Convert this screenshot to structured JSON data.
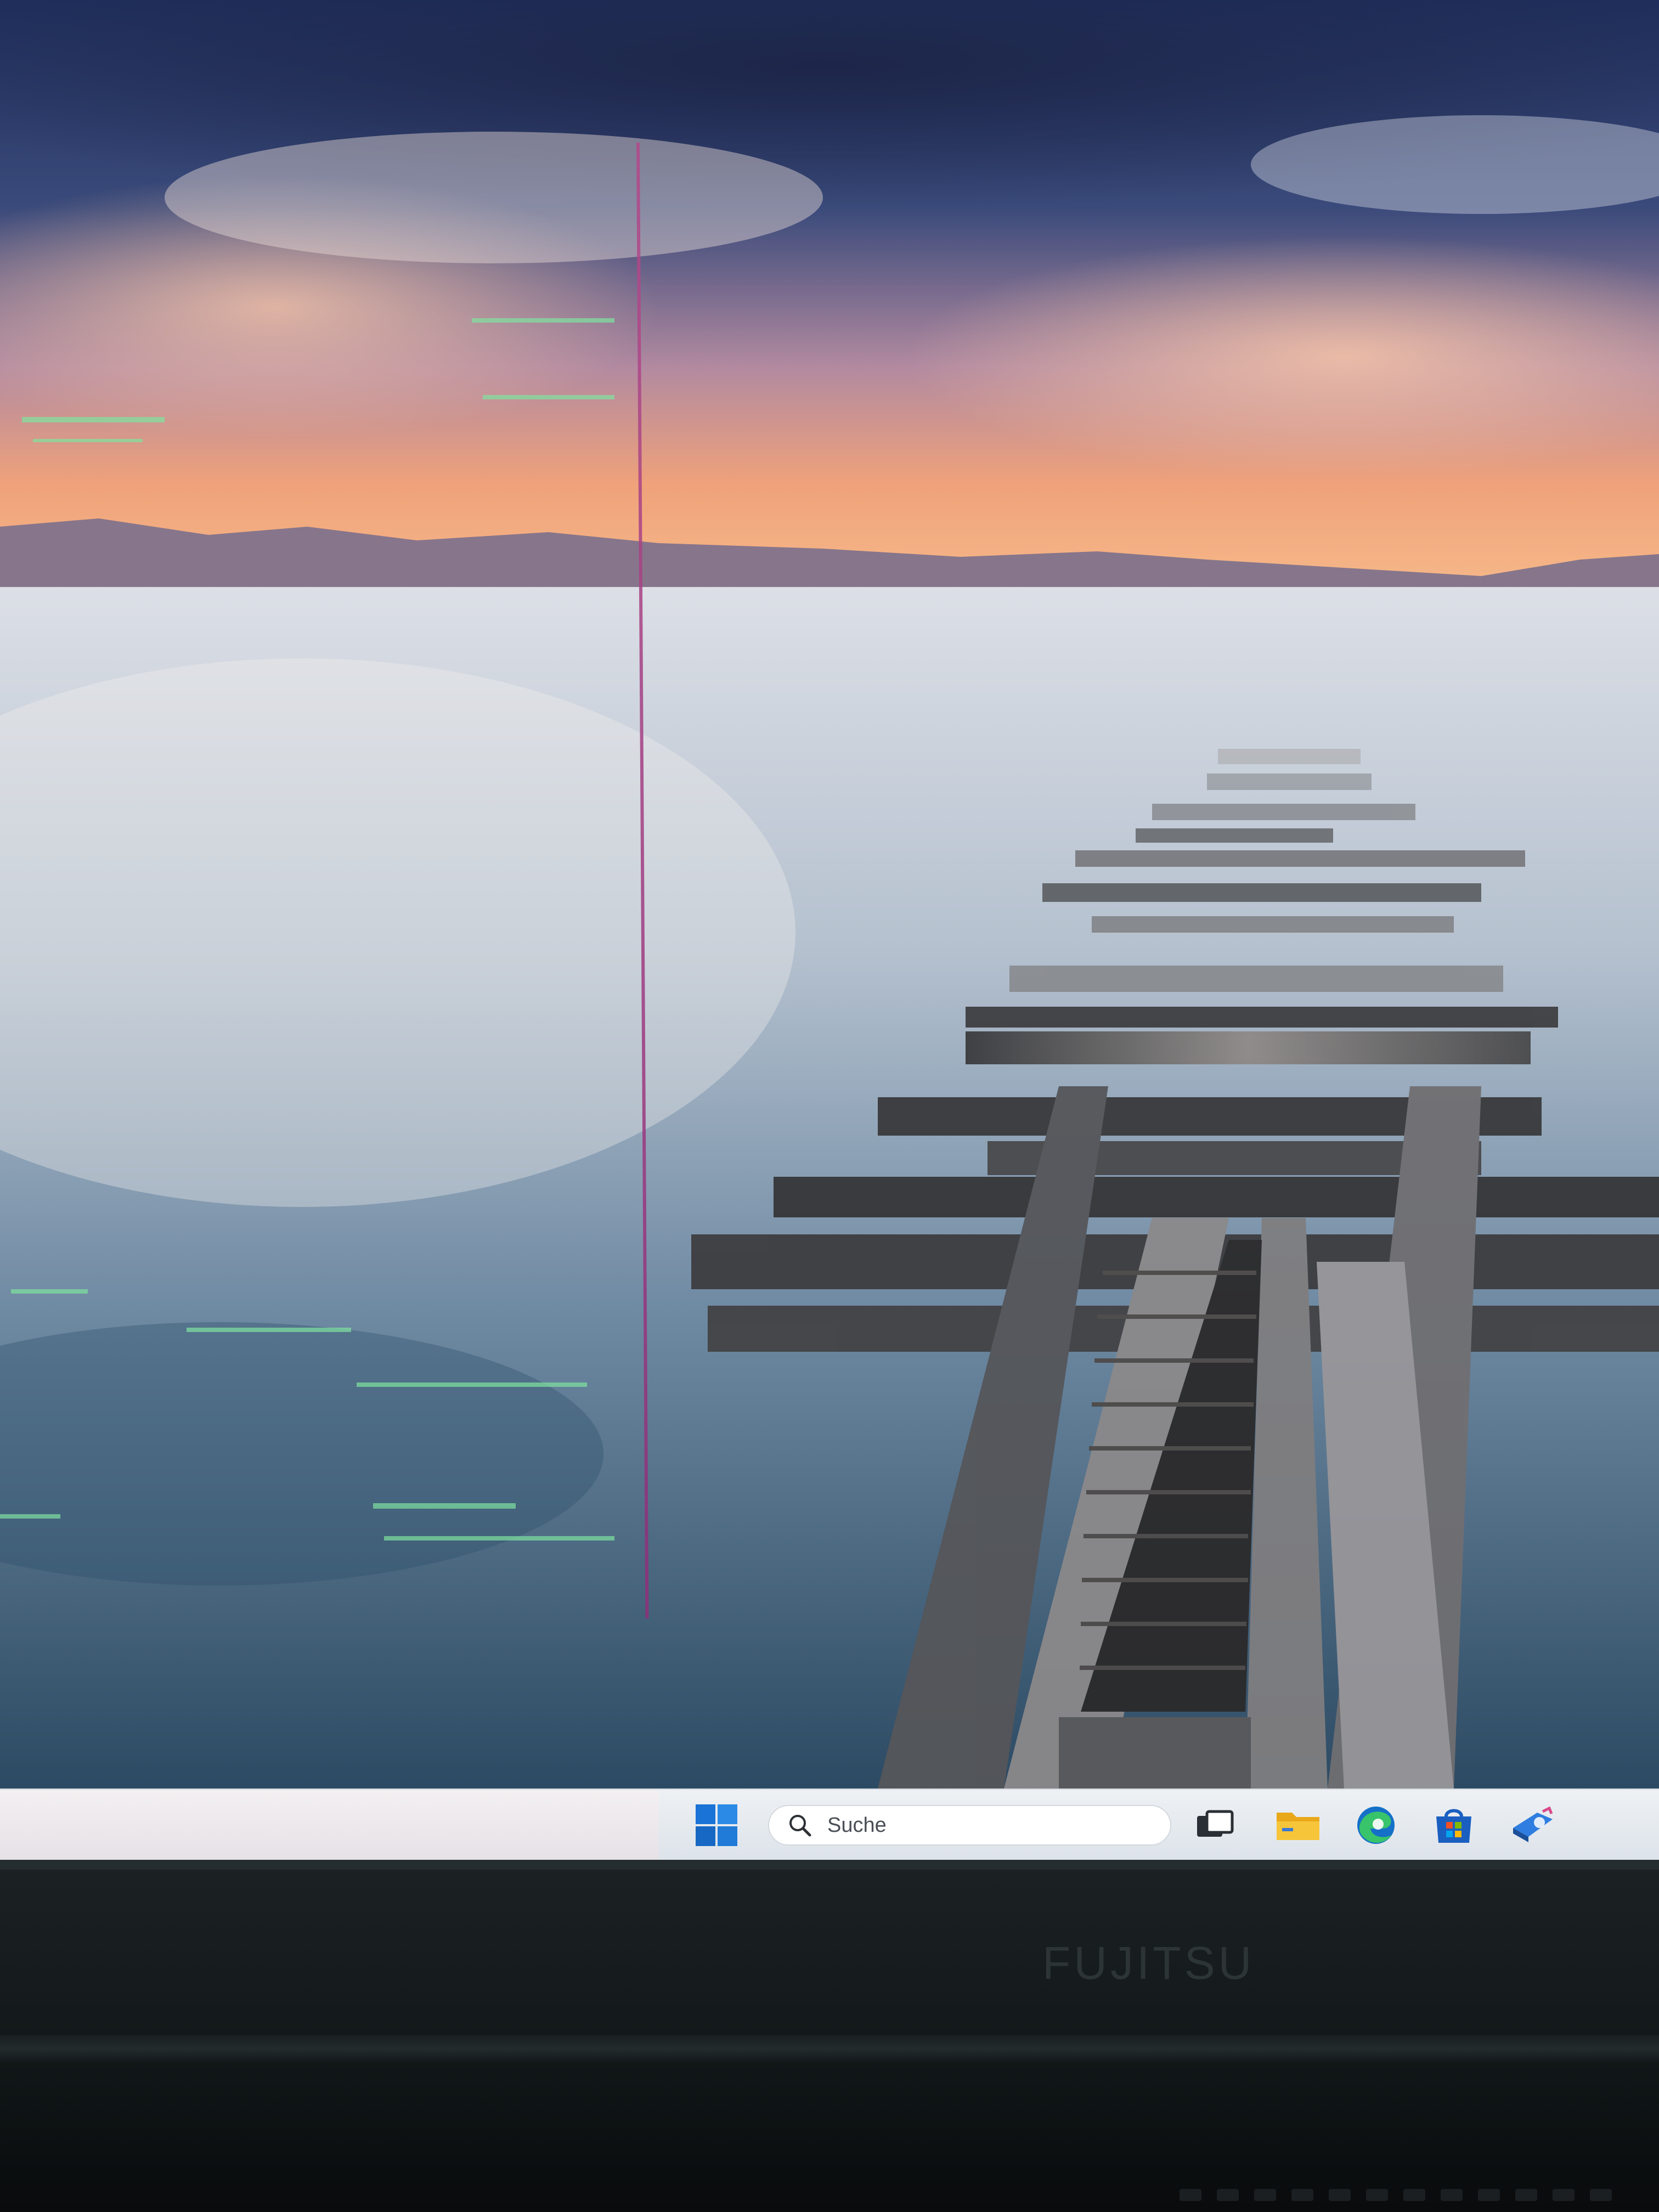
{
  "taskbar": {
    "search_placeholder": "Suche",
    "items": [
      {
        "name": "start",
        "icon": "windows-logo-icon"
      },
      {
        "name": "search",
        "icon": "search-icon"
      },
      {
        "name": "task-view",
        "icon": "task-view-icon"
      },
      {
        "name": "file-explorer",
        "icon": "folder-icon"
      },
      {
        "name": "edge",
        "icon": "edge-browser-icon"
      },
      {
        "name": "store",
        "icon": "microsoft-store-icon"
      },
      {
        "name": "other-app",
        "icon": "app-icon"
      }
    ]
  },
  "device": {
    "brand": "FUJITSU"
  },
  "colors": {
    "accent": "#0078d4",
    "taskbar_bg": "#e9edf1",
    "bezel": "#161b1c"
  }
}
